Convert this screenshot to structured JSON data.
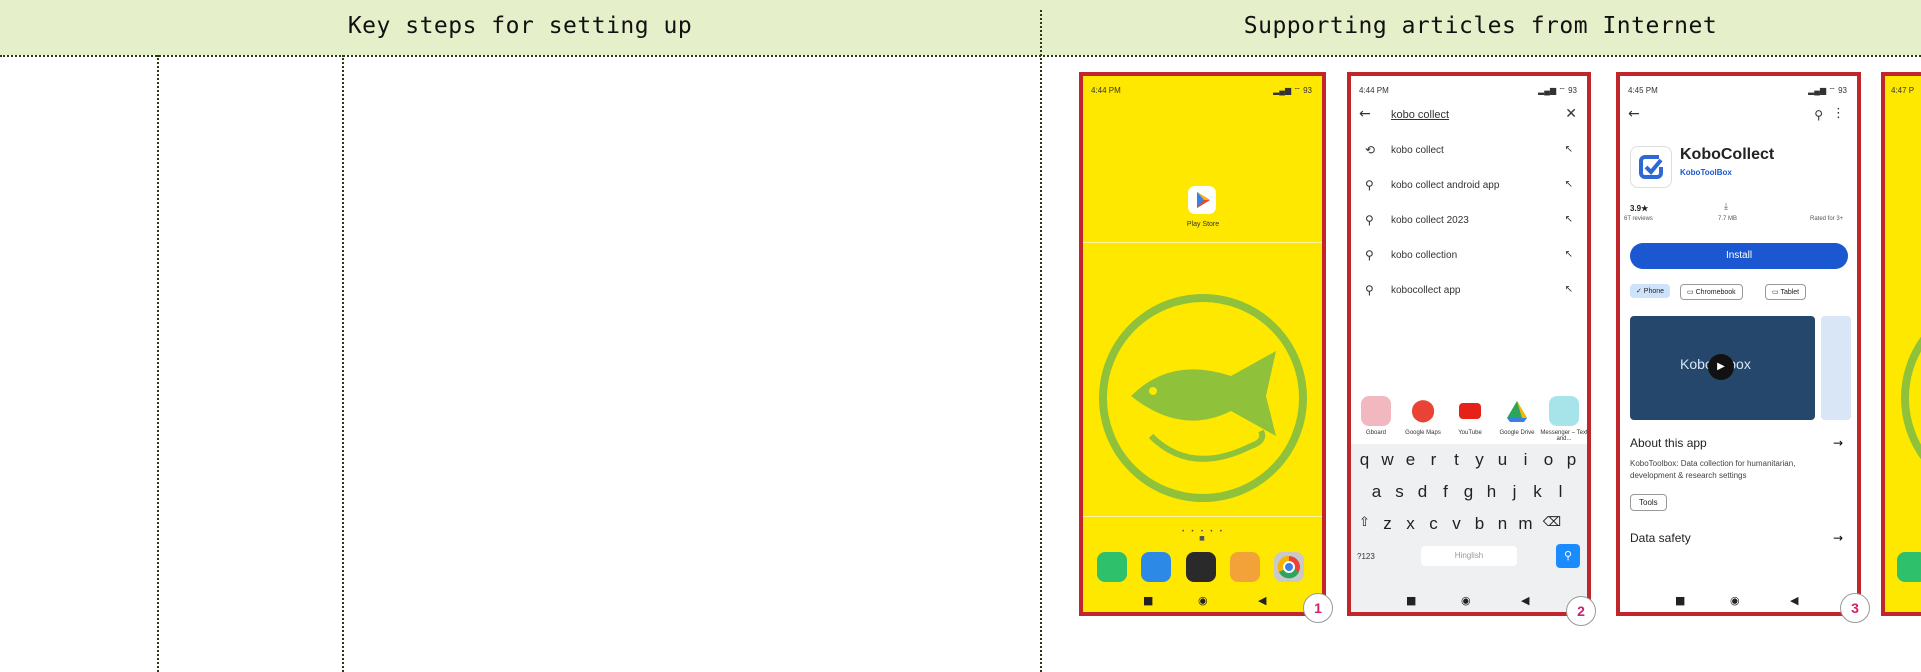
{
  "header": {
    "left_title": "Key steps for setting up",
    "right_title": "Supporting articles from Internet"
  },
  "phone1": {
    "time": "4:44 PM",
    "battery": "93",
    "play_store_label": "Play Store",
    "badge": "1"
  },
  "phone2": {
    "time": "4:44 PM",
    "battery": "93",
    "search_text": "kobo collect",
    "suggestions": [
      "kobo collect",
      "kobo collect android app",
      "kobo collect 2023",
      "kobo collection",
      "kobocollect app"
    ],
    "apps": [
      "Gboard",
      "Google Maps",
      "YouTube",
      "Google Drive",
      "Messenger – Text and..."
    ],
    "keyboard_row1": [
      "q",
      "w",
      "e",
      "r",
      "t",
      "y",
      "u",
      "i",
      "o",
      "p"
    ],
    "keyboard_row2": [
      "a",
      "s",
      "d",
      "f",
      "g",
      "h",
      "j",
      "k",
      "l"
    ],
    "keyboard_row3": [
      "z",
      "x",
      "c",
      "v",
      "b",
      "n",
      "m"
    ],
    "sym_key": "?123",
    "space_label": "Hinglish",
    "badge": "2"
  },
  "phone3": {
    "time": "4:45 PM",
    "battery": "93",
    "app_name": "KoboCollect",
    "developer": "KoboToolBox",
    "rating": "3.9★",
    "reviews": "6T reviews",
    "size": "7.7 MB",
    "rated": "Rated for 3+",
    "install_label": "Install",
    "chips": [
      "✓ Phone",
      "Chromebook",
      "Tablet"
    ],
    "video_text": "Kobo    box",
    "about_title": "About this app",
    "about_text": "KoboToolbox: Data collection for humanitarian, development & research settings",
    "tag": "Tools",
    "safety_title": "Data safety",
    "badge": "3"
  },
  "phone4": {
    "time": "4:47 P"
  },
  "colors": {
    "header_bg": "#e5efc9",
    "frame": "#c0262b",
    "home_bg": "#ffe800",
    "logo_green": "#8fc23a",
    "badge_text": "#d0206a",
    "install_blue": "#1a57d0"
  },
  "icons": [
    "arrow-left-icon",
    "close-icon",
    "history-icon",
    "search-icon",
    "arrow-up-left-icon",
    "more-vert-icon",
    "arrow-right-icon",
    "play-icon",
    "download-icon",
    "backspace-icon",
    "shift-icon",
    "home-nav-icon",
    "back-nav-icon",
    "recents-nav-icon"
  ]
}
